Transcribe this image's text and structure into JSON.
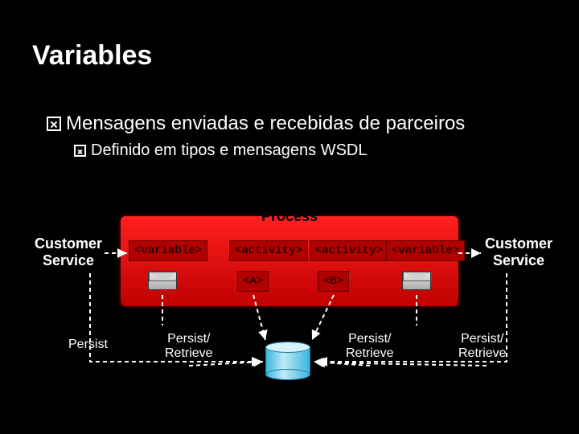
{
  "title": "Variables",
  "bullets": {
    "main": "Mensagens enviadas e recebidas de parceiros",
    "sub": "Definido em tipos e mensagens WSDL"
  },
  "customer_left": "Customer\nService",
  "customer_right": "Customer\nService",
  "process_label": "Process",
  "tokens": {
    "var1": "<variable>",
    "act1": "<activity>",
    "act2": "<activity>",
    "var2": "<variable>",
    "a": "<A>",
    "b": "<B>"
  },
  "bottom": {
    "persist": "Persist",
    "pr1": "Persist/\nRetrieve",
    "pr2": "Persist/\nRetrieve",
    "pr3": "Persist/\nRetrieve"
  }
}
